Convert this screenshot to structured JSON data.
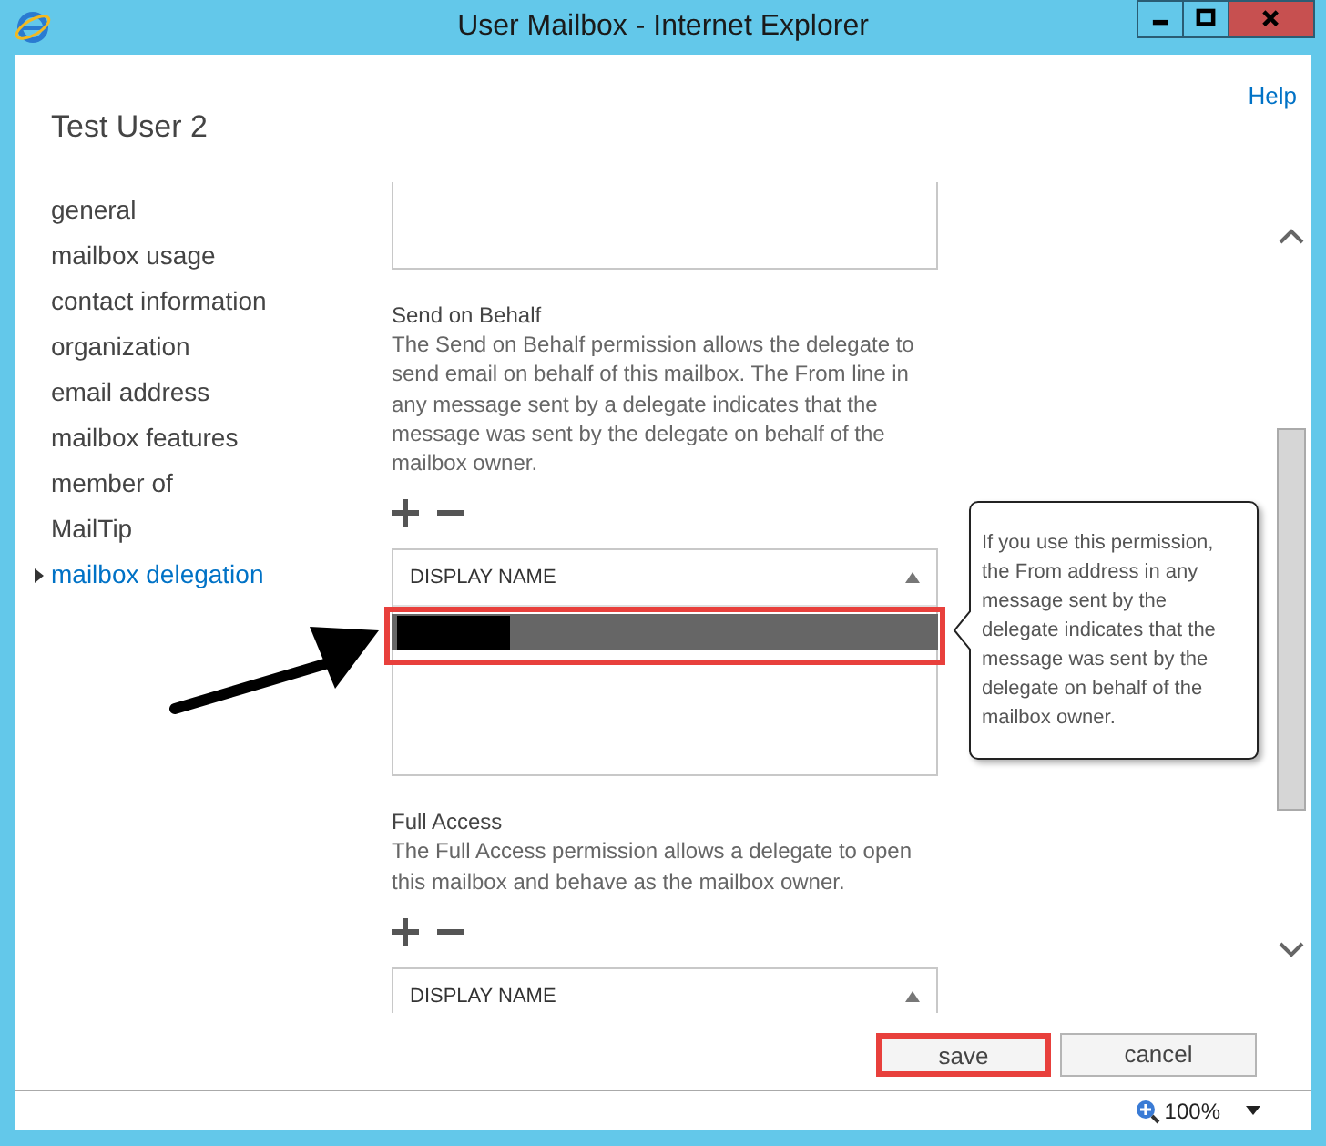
{
  "window": {
    "title": "User Mailbox - Internet Explorer"
  },
  "help_link": "Help",
  "page_title": "Test User 2",
  "nav": [
    {
      "label": "general",
      "selected": false
    },
    {
      "label": "mailbox usage",
      "selected": false
    },
    {
      "label": "contact information",
      "selected": false
    },
    {
      "label": "organization",
      "selected": false
    },
    {
      "label": "email address",
      "selected": false
    },
    {
      "label": "mailbox features",
      "selected": false
    },
    {
      "label": "member of",
      "selected": false
    },
    {
      "label": "MailTip",
      "selected": false
    },
    {
      "label": "mailbox delegation",
      "selected": true
    }
  ],
  "sections": [
    {
      "title": "Send on Behalf",
      "description": "The Send on Behalf permission allows the delegate to send email on behalf of this mailbox. The From line in any message sent by a delegate indicates that the message was sent by the delegate on behalf of the mailbox owner.",
      "table": {
        "column": "DISPLAY NAME",
        "rows": [
          {
            "redacted": true,
            "selected": true,
            "highlighted": true
          }
        ]
      }
    },
    {
      "title": "Full Access",
      "description": "The Full Access permission allows a delegate to open this mailbox and behave as the mailbox owner.",
      "table": {
        "column": "DISPLAY NAME"
      }
    }
  ],
  "tooltip": "If you use this permission, the From address in any message sent by the delegate indicates that the message was sent by the delegate on behalf of the mailbox owner.",
  "buttons": [
    {
      "label": "save",
      "highlighted": true
    },
    {
      "label": "cancel",
      "highlighted": false
    }
  ],
  "status_bar": {
    "zoom": "100%"
  }
}
